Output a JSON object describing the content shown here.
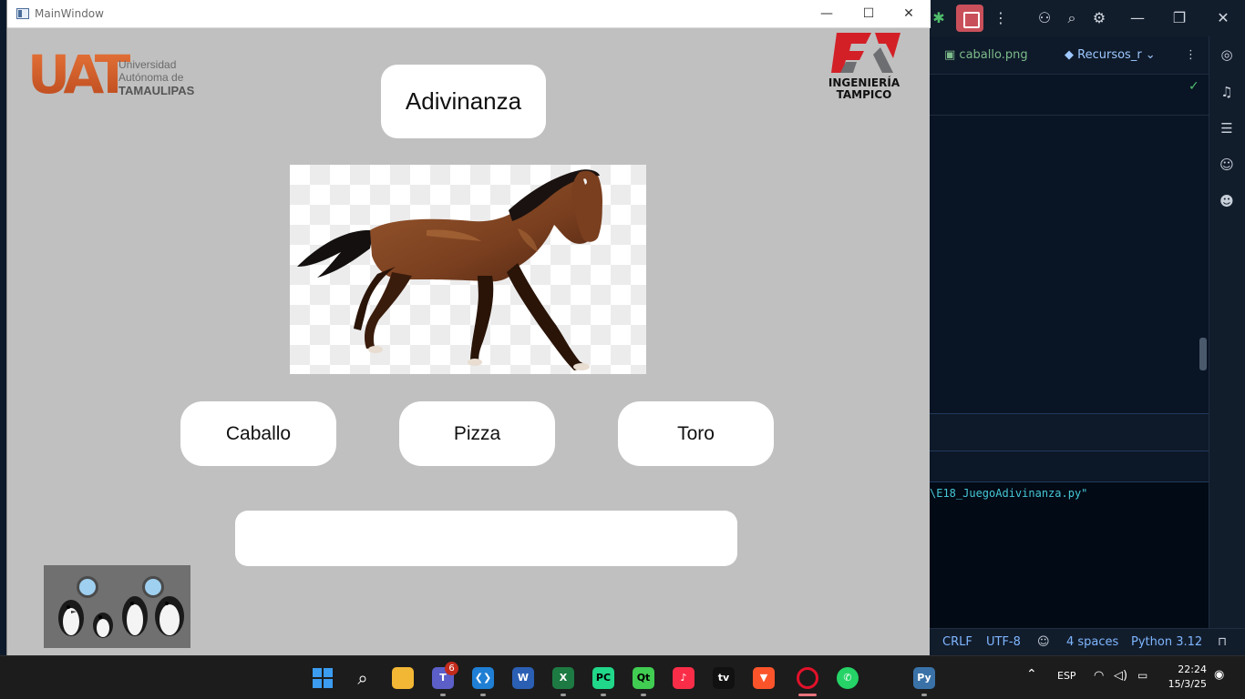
{
  "window": {
    "title": "MainWindow",
    "minimize_glyph": "—",
    "maximize_glyph": "☐",
    "close_glyph": "✕"
  },
  "logos": {
    "uat": {
      "mark": "UAT",
      "line1": "Universidad",
      "line2": "Autónoma de",
      "line3": "TAMAULIPAS"
    },
    "fi": {
      "mark": "FI",
      "line1": "INGENIERÍA",
      "line2": "TAMPICO"
    }
  },
  "game": {
    "title": "Adivinanza",
    "image_subject": "horse",
    "options": [
      "Caballo",
      "Pizza",
      "Toro"
    ],
    "answer_text": ""
  },
  "ide": {
    "tabs": [
      "caballo.png",
      "Recursos_r"
    ],
    "console_line": "\\E18_JuegoAdivinanza.py\"",
    "status": {
      "line_ending": "CRLF",
      "encoding": "UTF-8",
      "indent": "4 spaces",
      "interpreter": "Python 3.12"
    }
  },
  "taskbar": {
    "teams_badge": "6",
    "tray_lang": "ESP",
    "time": "22:24",
    "date": "15/3/25",
    "apps": [
      "windows-start-icon",
      "search-icon",
      "file-explorer-icon",
      "teams-icon",
      "vscode-icon",
      "word-icon",
      "excel-icon",
      "pycharm-icon",
      "qt-designer-icon",
      "music-icon",
      "apple-tv-icon",
      "brave-icon",
      "opera-icon",
      "whatsapp-icon",
      "python-icon"
    ]
  },
  "colors": {
    "window_bg": "#c0c0c0",
    "button_bg": "#ffffff",
    "uat_orange": "#d9602b",
    "fi_red": "#d32027"
  }
}
